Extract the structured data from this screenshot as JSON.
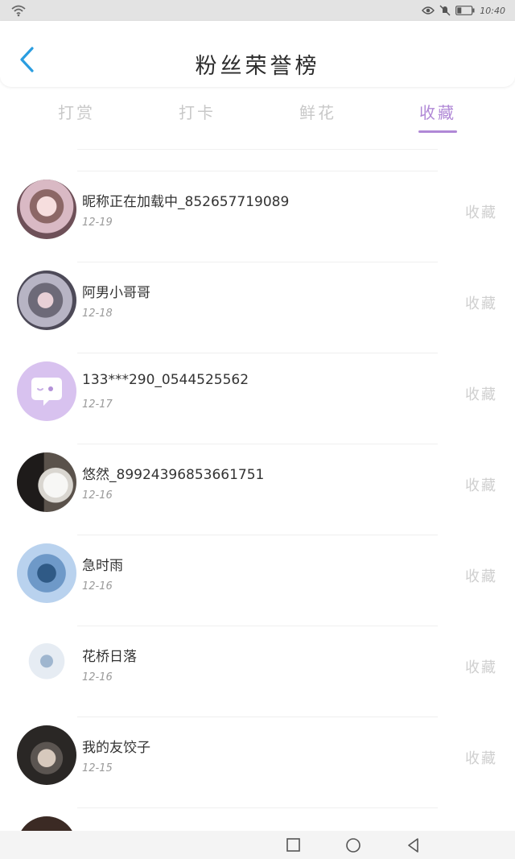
{
  "status_bar": {
    "time": "10:40"
  },
  "header": {
    "title": "粉丝荣誉榜"
  },
  "tabs": [
    {
      "label": "打赏"
    },
    {
      "label": "打卡"
    },
    {
      "label": "鲜花"
    },
    {
      "label": "收藏"
    }
  ],
  "colors": {
    "accent": "#b088d6",
    "muted": "#cfcfcf",
    "back_arrow": "#2a9de0"
  },
  "fans": [
    {
      "name": "昵称正在加载中_852657719089",
      "date": "12-19",
      "action": "收藏",
      "avatar_icon": "anime-girl-avatar"
    },
    {
      "name": "阿男小哥哥",
      "date": "12-18",
      "action": "收藏",
      "avatar_icon": "anime-character-avatar"
    },
    {
      "name": "133***290_0544525562",
      "date": "12-17",
      "action": "收藏",
      "avatar_icon": "chat-bubble-avatar"
    },
    {
      "name": "悠然_89924396853661751",
      "date": "12-16",
      "action": "收藏",
      "avatar_icon": "dog-photo-avatar"
    },
    {
      "name": "急时雨",
      "date": "12-16",
      "action": "收藏",
      "avatar_icon": "flowers-photo-avatar"
    },
    {
      "name": "花桥日落",
      "date": "12-16",
      "action": "收藏",
      "avatar_icon": "illustration-avatar"
    },
    {
      "name": "我的友饺子",
      "date": "12-15",
      "action": "收藏",
      "avatar_icon": "person-photo-avatar"
    },
    {
      "name": "",
      "date": "",
      "action": "",
      "avatar_icon": "partial-avatar"
    }
  ]
}
